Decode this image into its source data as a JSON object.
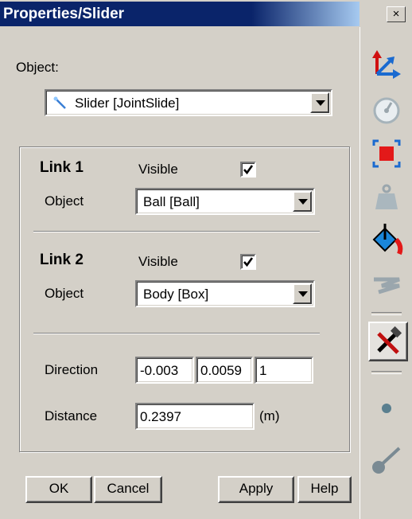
{
  "window": {
    "title": "Properties/Slider",
    "close_glyph": "×"
  },
  "object": {
    "label": "Object:",
    "value": "Slider  [JointSlide]",
    "icon": "slider-joint-icon"
  },
  "link1": {
    "title": "Link 1",
    "visible_label": "Visible",
    "visible_checked": true,
    "object_label": "Object",
    "object_value": "Ball  [Ball]"
  },
  "link2": {
    "title": "Link 2",
    "visible_label": "Visible",
    "visible_checked": true,
    "object_label": "Object",
    "object_value": "Body  [Box]"
  },
  "direction": {
    "label": "Direction",
    "x": "-0.003",
    "y": "0.0059",
    "z": "1"
  },
  "distance": {
    "label": "Distance",
    "value": "0.2397",
    "unit": "(m)"
  },
  "buttons": {
    "ok": "OK",
    "cancel": "Cancel",
    "apply": "Apply",
    "help": "Help"
  },
  "toolbar": {
    "items": [
      "coordinate-axes-icon",
      "gauge-icon",
      "selection-box-icon",
      "weight-icon",
      "paint-bucket-icon",
      "spring-icon",
      "tools-icon",
      "point-icon",
      "rod-icon"
    ],
    "active": "tools-icon"
  },
  "colors": {
    "title_bar": "#0a246a",
    "face": "#d4d0c8",
    "check": "#000000"
  }
}
